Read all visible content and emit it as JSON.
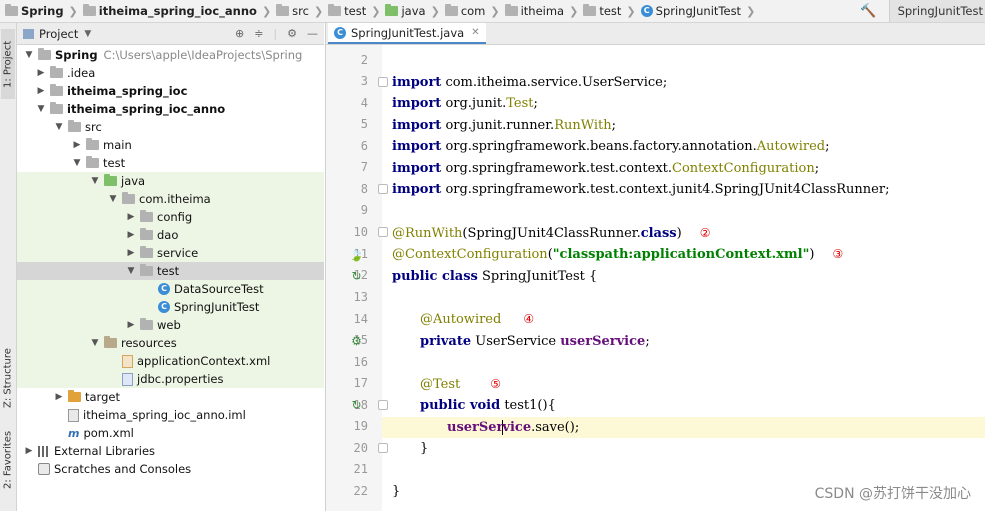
{
  "breadcrumbs": [
    "Spring",
    "itheima_spring_ioc_anno",
    "src",
    "test",
    "java",
    "com",
    "itheima",
    "test",
    "SpringJunitTest"
  ],
  "run_config": "SpringJunitTest",
  "side_tabs": {
    "project": "1: Project",
    "structure": "Z: Structure",
    "favorites": "2: Favorites"
  },
  "project_panel": {
    "title": "Project",
    "tree": [
      {
        "label": "Spring",
        "extra": "C:\\Users\\apple\\IdeaProjects\\Spring"
      },
      {
        "label": ".idea"
      },
      {
        "label": "itheima_spring_ioc"
      },
      {
        "label": "itheima_spring_ioc_anno"
      },
      {
        "label": "src"
      },
      {
        "label": "main"
      },
      {
        "label": "test"
      },
      {
        "label": "java"
      },
      {
        "label": "com.itheima"
      },
      {
        "label": "config"
      },
      {
        "label": "dao"
      },
      {
        "label": "service"
      },
      {
        "label": "test"
      },
      {
        "label": "DataSourceTest"
      },
      {
        "label": "SpringJunitTest"
      },
      {
        "label": "web"
      },
      {
        "label": "resources"
      },
      {
        "label": "applicationContext.xml"
      },
      {
        "label": "jdbc.properties"
      },
      {
        "label": "target"
      },
      {
        "label": "itheima_spring_ioc_anno.iml"
      },
      {
        "label": "pom.xml"
      },
      {
        "label": "External Libraries"
      },
      {
        "label": "Scratches and Consoles"
      }
    ]
  },
  "editor": {
    "tab": "SpringJunitTest.java",
    "line_numbers": [
      "2",
      "3",
      "4",
      "5",
      "6",
      "7",
      "8",
      "9",
      "10",
      "11",
      "12",
      "13",
      "14",
      "15",
      "16",
      "17",
      "18",
      "19",
      "20",
      "21",
      "22"
    ],
    "code": {
      "l3a": "import",
      "l3b": " com.itheima.service.UserService;",
      "l4a": "import",
      "l4b": " org.junit.",
      "l4c": "Test",
      "l4d": ";",
      "l5a": "import",
      "l5b": " org.junit.runner.",
      "l5c": "RunWith",
      "l5d": ";",
      "l6a": "import",
      "l6b": " org.springframework.beans.factory.annotation.",
      "l6c": "Autowired",
      "l6d": ";",
      "l7a": "import",
      "l7b": " org.springframework.test.context.",
      "l7c": "ContextConfiguration",
      "l7d": ";",
      "l8a": "import",
      "l8b": " org.springframework.test.context.junit4.SpringJUnit4ClassRunner;",
      "l10a": "@RunWith",
      "l10b": "(SpringJUnit4ClassRunner.",
      "l10c": "class",
      "l10d": ")",
      "l11a": "@ContextConfiguration",
      "l11b": "(",
      "l11c": "\"classpath:applicationContext.xml\"",
      "l11d": ")",
      "l12a": "public class",
      "l12b": " SpringJunitTest {",
      "l14a": "@Autowired",
      "l15a": "private",
      "l15b": " UserService ",
      "l15c": "userService",
      "l15d": ";",
      "l17a": "@Test",
      "l18a": "public void",
      "l18b": " test1(){",
      "l19a": "userSer",
      "l19b": "vice",
      "l19c": ".save();",
      "l20a": "}",
      "l22a": "}"
    },
    "markers": {
      "m10": "②",
      "m11": "③",
      "m14": "④",
      "m17": "⑤"
    }
  },
  "watermark": "CSDN @苏打饼干没加心"
}
